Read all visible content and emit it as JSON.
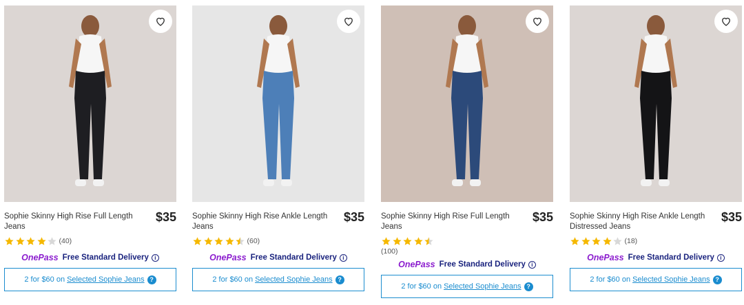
{
  "colors": {
    "accent": "#1a8ccf",
    "onepass": "#8b1cce",
    "delivery": "#1a237e",
    "star": "#f5b800"
  },
  "products": [
    {
      "title": "Sophie Skinny High Rise Full Length Jeans",
      "price": "$35",
      "rating": 4,
      "review_count": "(40)",
      "onepass_logo": "OnePass",
      "delivery_text": "Free Standard Delivery",
      "promo_prefix": "2 for $60 on",
      "promo_link": "Selected Sophie Jeans",
      "jeans_color": "#1e1e22",
      "background": "#dcd6d3"
    },
    {
      "title": "Sophie Skinny High Rise Ankle Length Jeans",
      "price": "$35",
      "rating": 4.5,
      "review_count": "(60)",
      "onepass_logo": "OnePass",
      "delivery_text": "Free Standard Delivery",
      "promo_prefix": "2 for $60 on",
      "promo_link": "Selected Sophie Jeans",
      "jeans_color": "#4d7fb8",
      "background": "#e6e6e6"
    },
    {
      "title": "Sophie Skinny High Rise Full Length Jeans",
      "price": "$35",
      "rating": 4.5,
      "review_count": "(100)",
      "onepass_logo": "OnePass",
      "delivery_text": "Free Standard Delivery",
      "promo_prefix": "2 for $60 on",
      "promo_link": "Selected Sophie Jeans",
      "jeans_color": "#2c4a7a",
      "background": "#cfbfb6"
    },
    {
      "title": "Sophie Skinny High Rise Ankle Length Distressed Jeans",
      "price": "$35",
      "rating": 4,
      "review_count": "(18)",
      "onepass_logo": "OnePass",
      "delivery_text": "Free Standard Delivery",
      "promo_prefix": "2 for $60 on",
      "promo_link": "Selected Sophie Jeans",
      "jeans_color": "#141416",
      "background": "#dcd6d3"
    }
  ]
}
